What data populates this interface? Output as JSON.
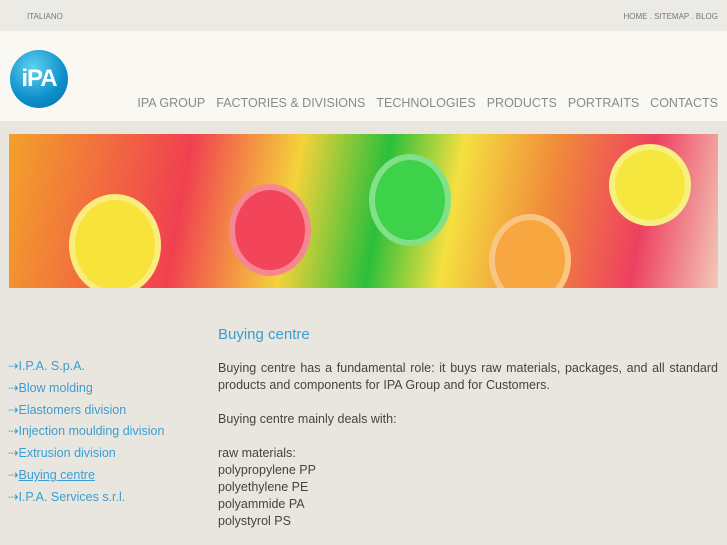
{
  "top": {
    "language": "ITALIANO",
    "links": "HOME . SITEMAP . BLOG"
  },
  "logo": {
    "text": "iPA"
  },
  "nav": [
    "IPA GROUP",
    "FACTORIES & DIVISIONS",
    "TECHNOLOGIES",
    "PRODUCTS",
    "PORTRAITS",
    "CONTACTS"
  ],
  "sidebar": [
    "I.P.A. S.p.A.",
    "Blow molding",
    "Elastomers division",
    "Injection moulding division",
    "Extrusion division",
    "Buying centre",
    "I.P.A. Services s.r.l."
  ],
  "content": {
    "title": "Buying centre",
    "p1": "Buying centre has a fundamental role: it buys raw materials, packages, and all standard products and components for IPA Group and for Customers.",
    "p2": "Buying centre mainly deals with:",
    "list_title": "raw materials:",
    "items": [
      "polypropylene PP",
      "polyethylene PE",
      "polyammide PA",
      "polystyrol PS"
    ]
  }
}
